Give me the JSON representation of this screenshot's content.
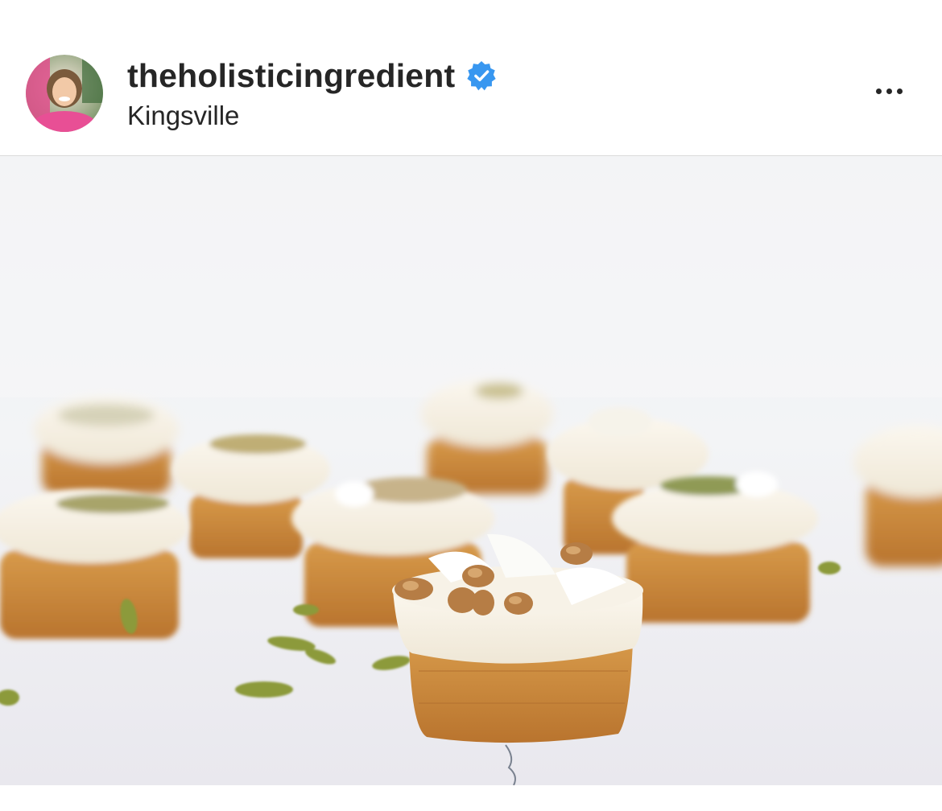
{
  "post": {
    "username": "theholisticingredient",
    "location": "Kingsville",
    "verified": true,
    "icons": {
      "avatar": "profile-photo",
      "verified": "verified-badge-icon",
      "more": "more-options-icon"
    },
    "colors": {
      "verified_badge": "#3897f0",
      "text": "#262626",
      "divider": "#dbdbdb"
    }
  }
}
